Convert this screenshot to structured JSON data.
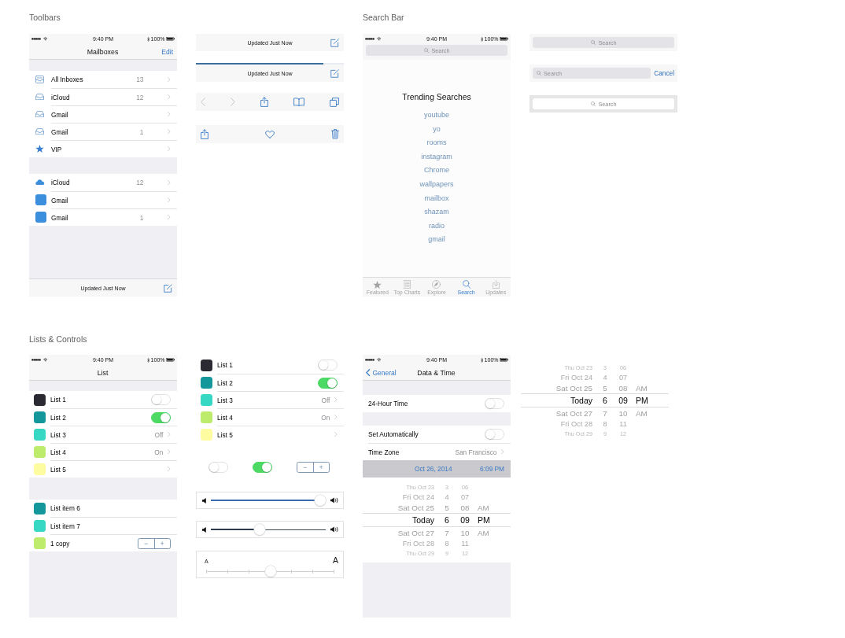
{
  "toolbars_section": {
    "heading": "Toolbars",
    "mail_screen": {
      "status_bar": {
        "time": "9:40 PM",
        "battery": "100%"
      },
      "nav_bar": {
        "title": "Mailboxes",
        "action": "Edit"
      },
      "groups": [
        {
          "rows": [
            {
              "kind": "inboxes",
              "label": "All Inboxes",
              "count": "13"
            },
            {
              "kind": "inbox",
              "label": "iCloud",
              "count": "12"
            },
            {
              "kind": "inbox",
              "label": "Gmail"
            },
            {
              "kind": "inbox",
              "label": "Gmail",
              "count": "1"
            },
            {
              "kind": "vip",
              "label": "VIP"
            }
          ]
        },
        {
          "rows": [
            {
              "kind": "cloud",
              "label": "iCloud",
              "count": "12"
            },
            {
              "kind": "account",
              "label": "Gmail"
            },
            {
              "kind": "account",
              "label": "Gmail",
              "count": "1"
            }
          ]
        }
      ],
      "toolbar": {
        "kind": "status",
        "status": "Updated Just Now"
      }
    },
    "toolbar_variants": [
      {
        "kind": "status",
        "status": "Updated Just Now"
      },
      {
        "kind": "status",
        "status": "Updated Just Now",
        "progress": {
          "level": 0.86
        }
      },
      {
        "kind": "buttons",
        "buttons": [
          {
            "kind": "back",
            "disabled": true
          },
          {
            "kind": "forward",
            "disabled": true
          },
          {
            "kind": "share",
            "disabled": false
          },
          {
            "kind": "bookmarks",
            "disabled": false
          },
          {
            "kind": "tabs",
            "disabled": false
          }
        ]
      },
      {
        "kind": "buttons",
        "buttons": [
          {
            "kind": "share",
            "disabled": false
          },
          {
            "kind": "favorite",
            "disabled": false
          },
          {
            "kind": "delete",
            "disabled": false
          }
        ]
      }
    ]
  },
  "search_section": {
    "heading": "Search Bar",
    "search_screen": {
      "status_bar": {
        "time": "9:40 PM",
        "battery": "100%"
      },
      "search_field": {
        "placeholder": "Search"
      },
      "trending": {
        "title": "Trending Searches",
        "items": [
          "youtube",
          "yo",
          "rooms",
          "instagram",
          "Chrome",
          "wallpapers",
          "mailbox",
          "shazam",
          "radio",
          "gmail"
        ]
      },
      "tab_bar": [
        {
          "kind": "featured",
          "label": "Featured",
          "selected": false
        },
        {
          "kind": "top_charts",
          "label": "Top Charts",
          "selected": false
        },
        {
          "kind": "explore",
          "label": "Explore",
          "selected": false
        },
        {
          "kind": "search",
          "label": "Search",
          "selected": true
        },
        {
          "kind": "updates",
          "label": "Updates",
          "selected": false
        }
      ]
    },
    "search_bar_variants": [
      {
        "kind": "default",
        "placeholder": "Search"
      },
      {
        "kind": "editing",
        "placeholder": "Search",
        "cancel": "Cancel"
      },
      {
        "kind": "inset",
        "placeholder": "Search"
      }
    ]
  },
  "lists_section": {
    "heading": "Lists & Controls",
    "list_screen": {
      "status_bar": {
        "time": "9:40 PM",
        "battery": "100%"
      },
      "nav_bar": {
        "title": "List"
      },
      "groups": [
        {
          "rows": [
            {
              "kind": "switch",
              "label": "List 1",
              "color": "#2b2a33",
              "on": false
            },
            {
              "kind": "switch",
              "label": "List 2",
              "color": "#13979b",
              "on": true
            },
            {
              "kind": "disclosure",
              "label": "List 3",
              "color": "#36d7c3",
              "value": "Off"
            },
            {
              "kind": "disclosure",
              "label": "List 4",
              "color": "#bdeb6c",
              "value": "On"
            },
            {
              "kind": "disclosure",
              "label": "List 5",
              "color": "#fdfca0"
            }
          ]
        },
        {
          "rows": [
            {
              "kind": "plain",
              "label": "List item 6",
              "color": "#13979b"
            },
            {
              "kind": "plain",
              "label": "List item 7",
              "color": "#36d7c3"
            },
            {
              "kind": "stepper",
              "label": "1 copy",
              "color": "#bdeb6c",
              "minus": "−",
              "plus": "+"
            }
          ]
        }
      ]
    },
    "list_variants": {
      "rows": [
        {
          "kind": "switch",
          "label": "List 1",
          "color": "#2b2a33",
          "on": false
        },
        {
          "kind": "switch",
          "label": "List 2",
          "color": "#13979b",
          "on": true
        },
        {
          "kind": "disclosure",
          "label": "List 3",
          "color": "#36d7c3",
          "value": "Off"
        },
        {
          "kind": "disclosure",
          "label": "List 4",
          "color": "#bdeb6c",
          "value": "On"
        },
        {
          "kind": "disclosure",
          "label": "List 5",
          "color": "#fdfca0"
        }
      ],
      "controls": [
        {
          "kind": "switch",
          "on": false
        },
        {
          "kind": "switch",
          "on": true
        },
        {
          "kind": "stepper",
          "minus": "−",
          "plus": "+"
        }
      ],
      "sliders": [
        {
          "kind": "volume",
          "level": 1,
          "color": "#3a6db0"
        },
        {
          "kind": "volume",
          "level": 0.42,
          "color": "#2e3b4c"
        },
        {
          "kind": "text_size",
          "level": 0.5,
          "small_label": "A",
          "large_label": "A"
        }
      ]
    },
    "date_time_screen": {
      "status_bar": {
        "time": "9:40 PM",
        "battery": "100%"
      },
      "nav_bar": {
        "back": "General",
        "title": "Data & Time"
      },
      "groups": [
        {
          "rows": [
            {
              "kind": "switch",
              "label": "24-Hour Time",
              "on": false
            }
          ]
        },
        {
          "rows": [
            {
              "kind": "switch",
              "label": "Set Automatically",
              "on": false
            },
            {
              "kind": "disclosure",
              "label": "Time Zone",
              "value": "San Francisco"
            }
          ]
        }
      ],
      "date_row": {
        "date": "Oct 26, 2014",
        "time": "6:09 PM",
        "selected": true
      },
      "picker": {
        "rows": [
          {
            "date": "Thu Oct 23",
            "hour": "3",
            "minute": "06",
            "selected": false
          },
          {
            "date": "Fri Oct 24",
            "hour": "4",
            "minute": "07",
            "selected": false
          },
          {
            "date": "Sat Oct 25",
            "hour": "5",
            "minute": "08",
            "period": "AM",
            "selected": false
          },
          {
            "date": "Today",
            "hour": "6",
            "minute": "09",
            "period": "PM",
            "selected": true
          },
          {
            "date": "Sat Oct 27",
            "hour": "7",
            "minute": "10",
            "period": "AM",
            "selected": false
          },
          {
            "date": "Fri Oct 28",
            "hour": "8",
            "minute": "11",
            "selected": false
          },
          {
            "date": "Thu Oct 29",
            "hour": "9",
            "minute": "12",
            "selected": false
          }
        ]
      }
    },
    "picker": {
      "rows": [
        {
          "date": "Thu Oct 23",
          "hour": "3",
          "minute": "06",
          "selected": false
        },
        {
          "date": "Fri Oct 24",
          "hour": "4",
          "minute": "07",
          "selected": false
        },
        {
          "date": "Sat Oct 25",
          "hour": "5",
          "minute": "08",
          "period": "AM",
          "selected": false
        },
        {
          "date": "Today",
          "hour": "6",
          "minute": "09",
          "period": "PM",
          "selected": true
        },
        {
          "date": "Sat Oct 27",
          "hour": "7",
          "minute": "10",
          "period": "AM",
          "selected": false
        },
        {
          "date": "Fri Oct 28",
          "hour": "8",
          "minute": "11",
          "selected": false
        },
        {
          "date": "Thu Oct 29",
          "hour": "9",
          "minute": "12",
          "selected": false
        }
      ]
    }
  }
}
